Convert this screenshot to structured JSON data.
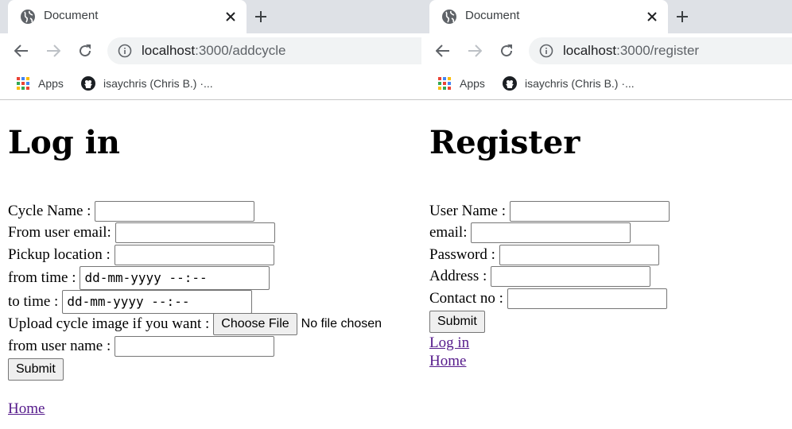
{
  "left": {
    "tab": {
      "title": "Document"
    },
    "address": {
      "host": "localhost",
      "path": ":3000/addcycle"
    },
    "bookmarks": {
      "apps": "Apps",
      "github": "isaychris (Chris B.) ·..."
    },
    "page": {
      "title": "Log in",
      "fields": {
        "cycle_name": "Cycle Name :",
        "from_user_email": "From user email:",
        "pickup_location": "Pickup location :",
        "from_time": "from time :",
        "from_time_value": "dd-mm-yyyy --:--",
        "to_time": "to time :",
        "to_time_value": "dd-mm-yyyy --:--",
        "upload": "Upload cycle image if you want :",
        "choose_file": "Choose File",
        "no_file": "No file chosen",
        "from_user_name": "from user name :"
      },
      "submit": "Submit",
      "home_link": "Home"
    }
  },
  "right": {
    "tab": {
      "title": "Document"
    },
    "address": {
      "host": "localhost",
      "path": ":3000/register"
    },
    "bookmarks": {
      "apps": "Apps",
      "github": "isaychris (Chris B.) ·..."
    },
    "page": {
      "title": "Register",
      "fields": {
        "user_name": "User Name :",
        "email": "email:",
        "password": "Password :",
        "address": "Address :",
        "contact_no": "Contact no :"
      },
      "submit": "Submit",
      "login_link": "Log in",
      "home_link": "Home"
    }
  }
}
